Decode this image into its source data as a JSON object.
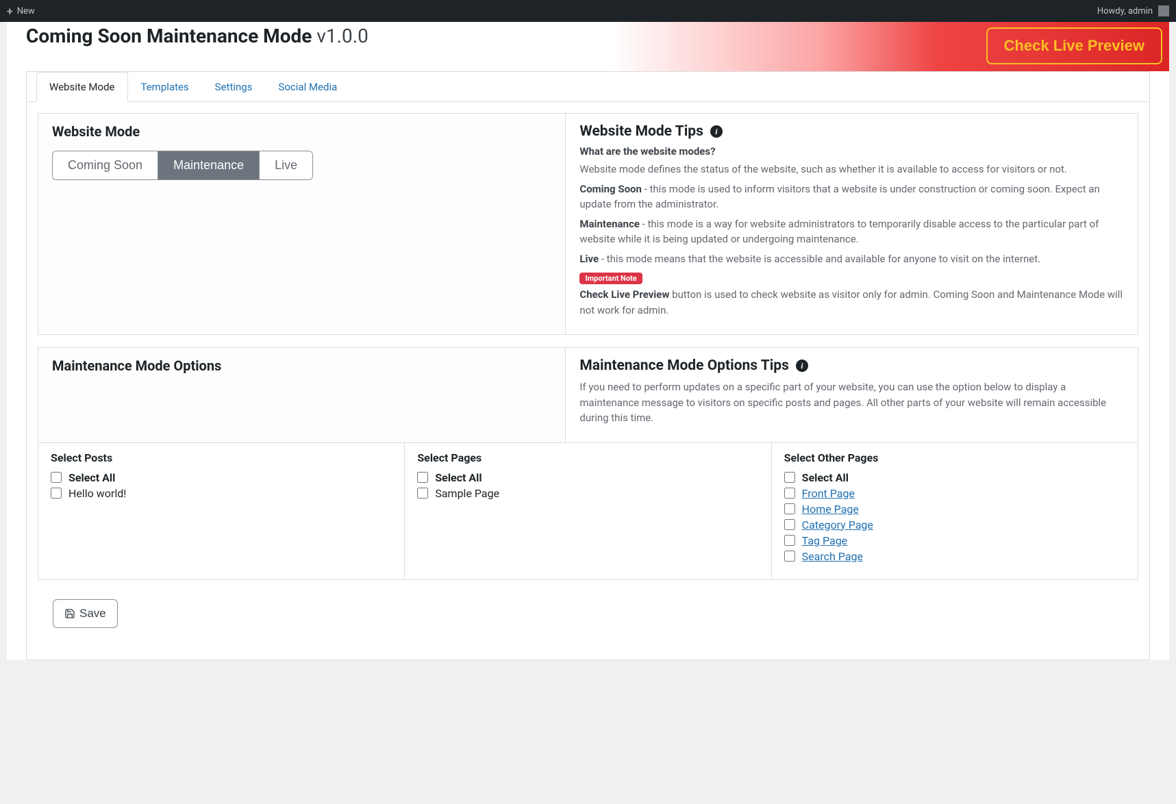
{
  "admin_bar": {
    "new_label": "New",
    "howdy": "Howdy, admin"
  },
  "header": {
    "title": "Coming Soon Maintenance Mode",
    "version": "v1.0.0",
    "preview_btn": "Check Live Preview"
  },
  "tabs": [
    {
      "label": "Website Mode",
      "active": true
    },
    {
      "label": "Templates",
      "active": false
    },
    {
      "label": "Settings",
      "active": false
    },
    {
      "label": "Social Media",
      "active": false
    }
  ],
  "website_mode": {
    "title": "Website Mode",
    "buttons": {
      "coming_soon": "Coming Soon",
      "maintenance": "Maintenance",
      "live": "Live"
    },
    "tips_title": "Website Mode Tips",
    "tips_q": "What are the website modes?",
    "tips_intro": "Website mode defines the status of the website, such as whether it is available to access for visitors or not.",
    "coming_soon_label": "Coming Soon",
    "coming_soon_text": " - this mode is used to inform visitors that a website is under construction or coming soon. Expect an update from the administrator.",
    "maintenance_label": "Maintenance",
    "maintenance_text": " - this mode is a way for website administrators to temporarily disable access to the particular part of website while it is being updated or undergoing maintenance.",
    "live_label": "Live",
    "live_text": " - this mode means that the website is accessible and available for anyone to visit on the internet.",
    "note_badge": "Important Note",
    "note_strong": "Check Live Preview",
    "note_text": " button is used to check website as visitor only for admin. Coming Soon and Maintenance Mode will not work for admin."
  },
  "options": {
    "title": "Maintenance Mode Options",
    "tips_title": "Maintenance Mode Options Tips",
    "tips_text": "If you need to perform updates on a specific part of your website, you can use the option below to display a maintenance message to visitors on specific posts and pages. All other parts of your website will remain accessible during this time."
  },
  "selects": {
    "posts": {
      "heading": "Select Posts",
      "select_all": "Select All",
      "items": [
        "Hello world!"
      ]
    },
    "pages": {
      "heading": "Select Pages",
      "select_all": "Select All",
      "items": [
        "Sample Page"
      ]
    },
    "other": {
      "heading": "Select Other Pages",
      "select_all": "Select All",
      "items": [
        "Front Page",
        "Home Page",
        "Category Page",
        "Tag Page",
        "Search Page"
      ]
    }
  },
  "save_label": "Save"
}
